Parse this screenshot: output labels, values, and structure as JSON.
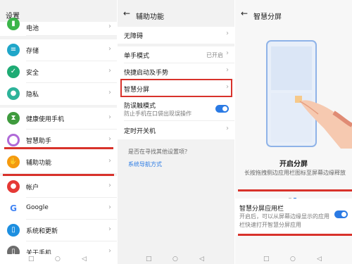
{
  "panel1": {
    "title": "设置",
    "items": [
      {
        "label": "电池",
        "icon": "battery-icon",
        "color": "#3bb54a"
      },
      {
        "label": "存储",
        "icon": "storage-icon",
        "color": "#1fa6c9"
      },
      {
        "label": "安全",
        "icon": "shield-icon",
        "color": "#1eab74"
      },
      {
        "label": "隐私",
        "icon": "privacy-icon",
        "color": "#2db39a"
      },
      {
        "label": "健康使用手机",
        "icon": "hourglass-icon",
        "color": "#3f9b3e"
      },
      {
        "label": "智慧助手",
        "icon": "assistant-icon",
        "color": "#b06ad8"
      },
      {
        "label": "辅助功能",
        "icon": "hand-icon",
        "color": "#f59a0e"
      },
      {
        "label": "帐户",
        "icon": "account-icon",
        "color": "#e53935"
      },
      {
        "label": "Google",
        "icon": "google-icon",
        "color": "#ffffff"
      },
      {
        "label": "系统和更新",
        "icon": "system-update-icon",
        "color": "#1d8fe0"
      },
      {
        "label": "关于手机",
        "icon": "phone-icon",
        "color": "#6d6d6d"
      }
    ]
  },
  "panel2": {
    "back_glyph": "←",
    "title": "辅助功能",
    "items": [
      {
        "label": "无障碍"
      },
      {
        "label": "单手模式",
        "value": "已开启"
      },
      {
        "label": "快捷启动及手势"
      },
      {
        "label": "智慧分屏"
      },
      {
        "label": "防误触模式",
        "sub": "防止手机在口袋出现误操作",
        "toggle": true
      },
      {
        "label": "定时开关机"
      }
    ],
    "hint": {
      "question": "是否在寻找其他设置项？",
      "link": "系统导航方式"
    }
  },
  "panel3": {
    "back_glyph": "←",
    "title": "智慧分屏",
    "section_title": "开启分屏",
    "section_desc": "长按拖拽侧边应用栏图标至屏幕边缘释放",
    "card": {
      "label": "智慧分屏应用栏",
      "sub": "开启后，可以从屏幕边缘显示的应用栏快速打开智慧分屏应用",
      "toggle": true
    }
  },
  "nav": {
    "recent": "□",
    "home": "○",
    "back": "◁"
  },
  "colors": {
    "accent": "#2a7ae4",
    "highlight": "#d8322b"
  }
}
